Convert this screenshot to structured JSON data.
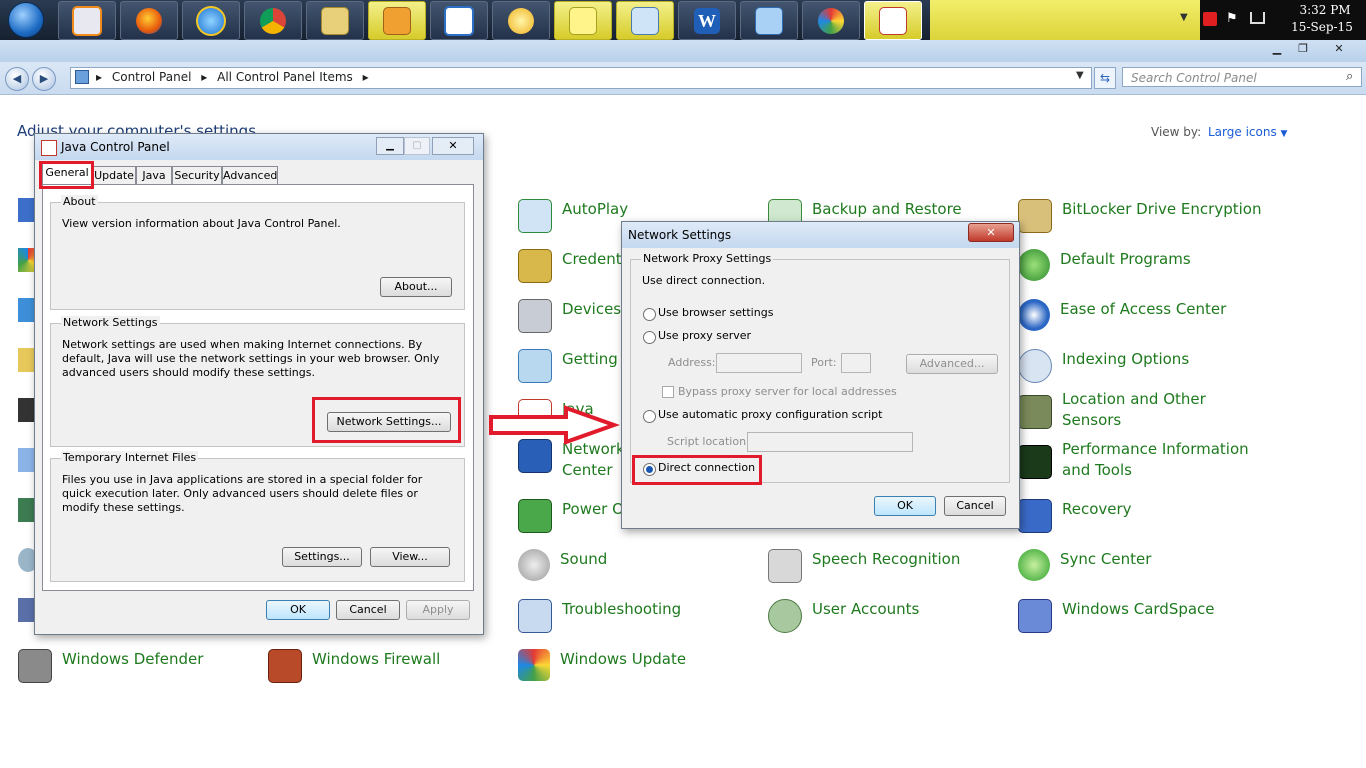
{
  "taskbar": {
    "clock_time": "3:32 PM",
    "clock_date": "15-Sep-15",
    "pinned_icons": [
      "media-player-icon",
      "firefox-icon",
      "ie-icon",
      "chrome-icon",
      "file-manager-icon",
      "outlook-icon",
      "network-diagram-icon",
      "weather-icon",
      "sticky-notes-icon",
      "notepad-icon",
      "word-icon",
      "control-panel-icon",
      "paint-icon",
      "java-icon"
    ]
  },
  "explorer": {
    "breadcrumb_1": "Control Panel",
    "breadcrumb_2": "All Control Panel Items",
    "search_placeholder": "Search Control Panel",
    "heading": "Adjust your computer's settings",
    "view_by_label": "View by:",
    "view_mode": "Large icons",
    "items": [
      {
        "label": "AutoPlay"
      },
      {
        "label": "Backup and Restore"
      },
      {
        "label": "BitLocker Drive Encryption"
      },
      {
        "label": "Credenti"
      },
      {
        "label": "Default Programs"
      },
      {
        "label": "Devices"
      },
      {
        "label": "Ease of Access Center"
      },
      {
        "label": "Getting S"
      },
      {
        "label": "Indexing Options"
      },
      {
        "label": "Java"
      },
      {
        "label": "Location and Other Sensors"
      },
      {
        "label": "Network Center"
      },
      {
        "label": "Performance Information and Tools"
      },
      {
        "label": "Power O"
      },
      {
        "label": "Recovery"
      },
      {
        "label": "Sound"
      },
      {
        "label": "Speech Recognition"
      },
      {
        "label": "Sync Center"
      },
      {
        "label": "Troubleshooting"
      },
      {
        "label": "User Accounts"
      },
      {
        "label": "Windows CardSpace"
      },
      {
        "label": "Windows Defender"
      },
      {
        "label": "Windows Firewall"
      },
      {
        "label": "Windows Update"
      }
    ]
  },
  "java_panel": {
    "title": "Java Control Panel",
    "tabs": [
      "General",
      "Update",
      "Java",
      "Security",
      "Advanced"
    ],
    "about_group": "About",
    "about_text": "View version information about Java Control Panel.",
    "about_button": "About...",
    "network_group": "Network Settings",
    "network_text": "Network settings are used when making Internet connections.  By default, Java will use the network settings in your web browser.  Only advanced users should modify these settings.",
    "network_button": "Network Settings...",
    "temp_group": "Temporary Internet Files",
    "temp_text": "Files you use in Java applications are stored in a special folder for quick execution later.  Only advanced users should delete files or modify these settings.",
    "settings_button": "Settings...",
    "view_button": "View...",
    "ok": "OK",
    "cancel": "Cancel",
    "apply": "Apply"
  },
  "network_dialog": {
    "title": "Network Settings",
    "group": "Network Proxy Settings",
    "status": "Use direct connection.",
    "opt_browser": "Use browser settings",
    "opt_proxy": "Use proxy server",
    "address_label": "Address:",
    "port_label": "Port:",
    "advanced_button": "Advanced...",
    "bypass_label": "Bypass proxy server for local addresses",
    "opt_auto": "Use automatic proxy configuration script",
    "script_label": "Script location:",
    "opt_direct": "Direct connection",
    "selected_option": "Direct connection",
    "ok": "OK",
    "cancel": "Cancel"
  },
  "annotation_color": "#e11b2c"
}
